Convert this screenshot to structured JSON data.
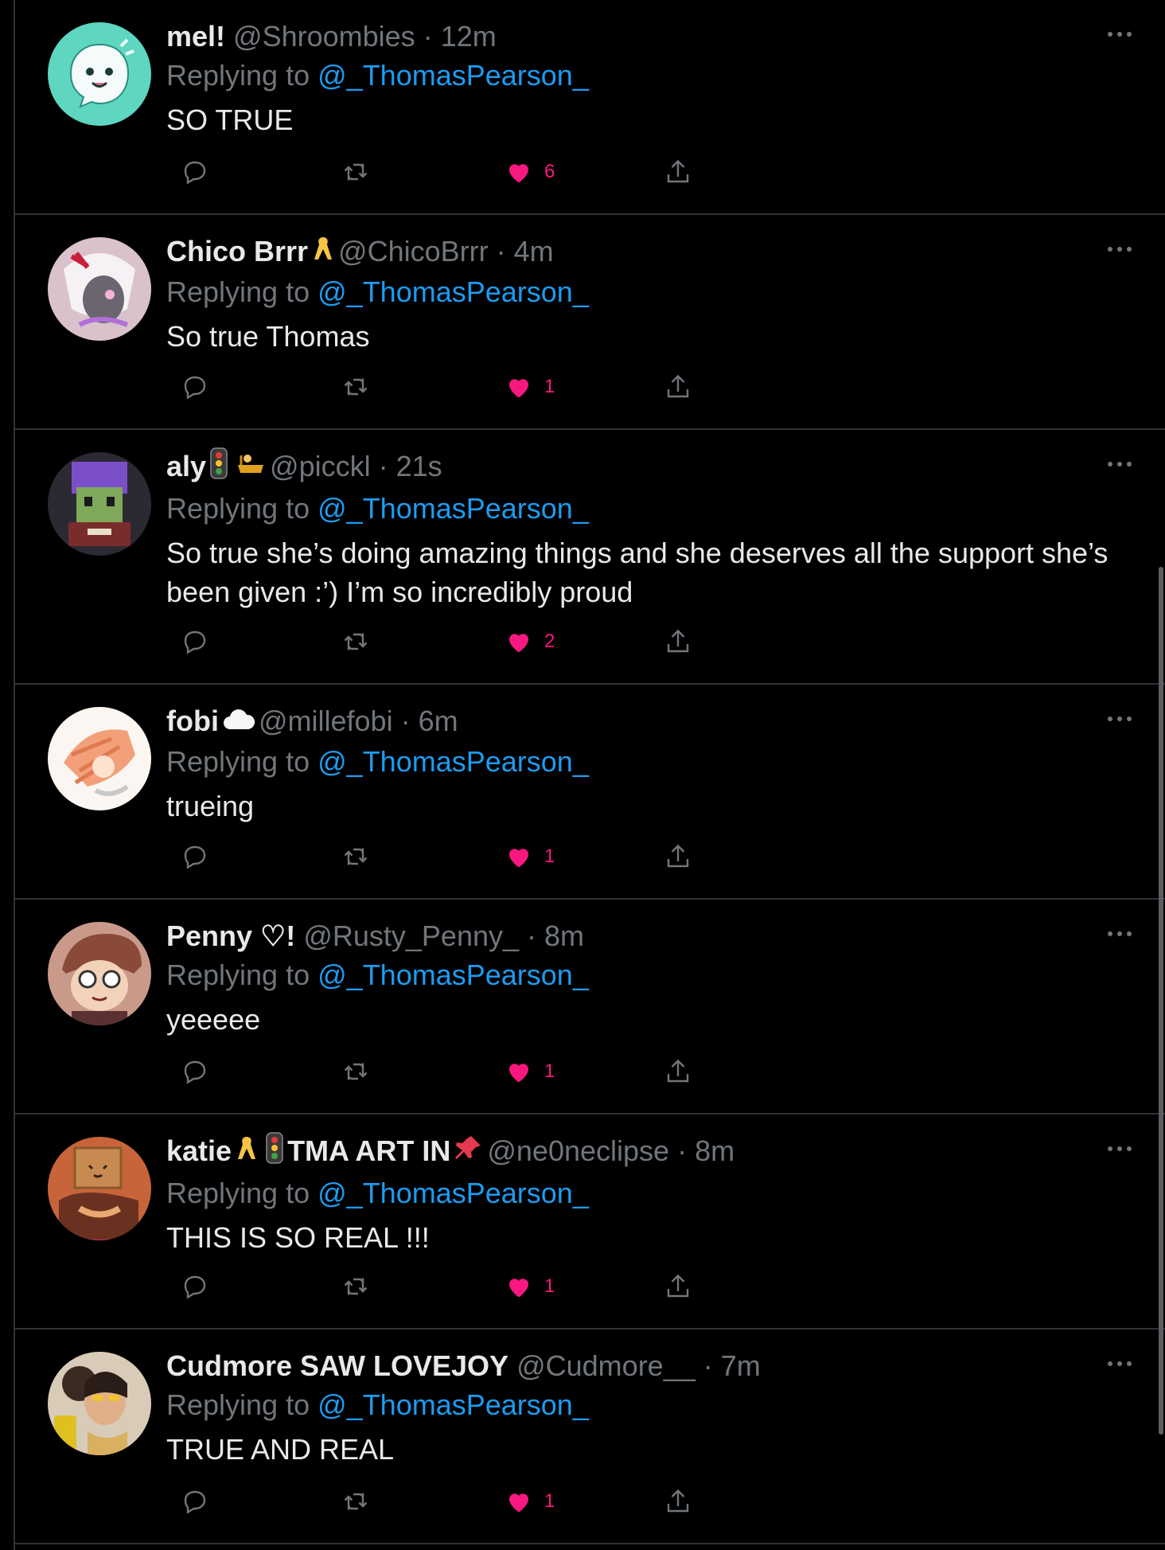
{
  "reply_prefix": "Replying to",
  "colors": {
    "accent": "#1d9bf0",
    "like": "#f91880",
    "muted": "#71767b",
    "text": "#e7e9ea",
    "background": "#000000"
  },
  "tweets": [
    {
      "name": "mel!",
      "badges": [],
      "handle": "@Shroombies",
      "time": "12m",
      "mention": "@_ThomasPearson_",
      "text": "SO TRUE",
      "likes": "6",
      "avatar": "white-ghost-on-teal"
    },
    {
      "name": "Chico Brrr",
      "badges": [
        "yellow-ribbon-emoji"
      ],
      "handle": "@ChicoBrrr",
      "time": "4m",
      "mention": "@_ThomasPearson_",
      "text": "So true Thomas",
      "likes": "1",
      "avatar": "white-haired-character"
    },
    {
      "name": "aly",
      "badges": [
        "traffic-light-emoji",
        "bathtub-emoji"
      ],
      "handle": "@picckl",
      "time": "21s",
      "mention": "@_ThomasPearson_",
      "text": "So true she’s doing amazing things and she deserves all the support she’s been given :’) I’m so incredibly proud",
      "likes": "2",
      "avatar": "pixel-art-character"
    },
    {
      "name": "fobi",
      "badges": [
        "cloud-emoji"
      ],
      "handle": "@millefobi",
      "time": "6m",
      "mention": "@_ThomasPearson_",
      "text": "trueing",
      "likes": "1",
      "avatar": "orange-haired-drawing"
    },
    {
      "name": "Penny ♡!",
      "badges": [],
      "handle": "@Rusty_Penny_",
      "time": "8m",
      "mention": "@_ThomasPearson_",
      "text": "yeeeee",
      "likes": "1",
      "avatar": "character-with-glasses"
    },
    {
      "name": "katie",
      "name_suffix": "TMA ART IN",
      "badges": [
        "yellow-ribbon-emoji",
        "traffic-light-emoji"
      ],
      "suffix_badges": [
        "pushpin-emoji"
      ],
      "handle": "@ne0neclipse",
      "time": "8m",
      "mention": "@_ThomasPearson_",
      "text": "THIS IS SO REAL !!!",
      "likes": "1",
      "avatar": "box-head-character"
    },
    {
      "name": "Cudmore SAW LOVEJOY",
      "badges": [],
      "handle": "@Cudmore__",
      "time": "7m",
      "mention": "@_ThomasPearson_",
      "text": "TRUE AND REAL",
      "likes": "1",
      "avatar": "photo-collage"
    }
  ]
}
